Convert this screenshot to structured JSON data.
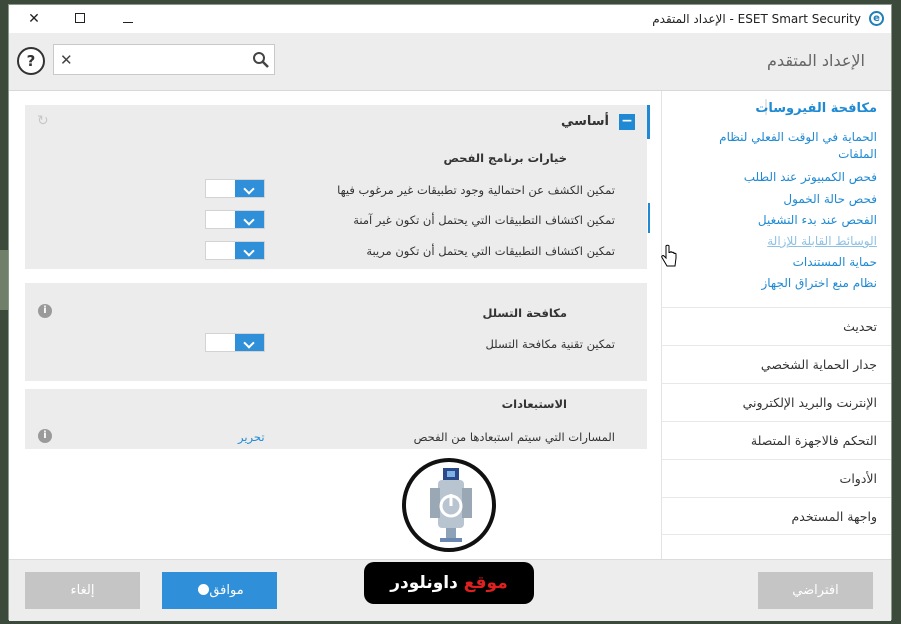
{
  "window": {
    "title": "ESET Smart Security - الإعداد المتقدم",
    "logo_letter": "e",
    "close_glyph": "✕"
  },
  "header": {
    "title": "الإعداد المتقدم",
    "help_glyph": "?",
    "search": {
      "value": "",
      "placeholder": "",
      "clear_glyph": "✕"
    }
  },
  "sidebar": {
    "section_title": "مكافحة الفيروسات",
    "sub_items": [
      {
        "label": "الحماية في الوقت الفعلي لنظام الملفات"
      },
      {
        "label": "فحص الكمبيوتر عند الطلب"
      },
      {
        "label": "فحص حالة الخمول"
      },
      {
        "label": "الفحص عند بدء التشغيل"
      },
      {
        "label": "الوسائط القابلة للإزالة"
      },
      {
        "label": "حماية المستندات"
      },
      {
        "label": "نظام منع اختراق الجهاز"
      }
    ],
    "items": [
      {
        "label": "تحديث"
      },
      {
        "label": "جدار الحماية الشخصي"
      },
      {
        "label": "الإنترنت والبريد الإلكتروني"
      },
      {
        "label": "التحكم فالاجهزة المتصلة"
      },
      {
        "label": "الأدوات"
      },
      {
        "label": "واجهة المستخدم"
      }
    ]
  },
  "main": {
    "section_title": "أساسي",
    "section_toggle": "−",
    "refresh_glyph": "↻",
    "groups": [
      {
        "title": "خيارات برنامج الفحص",
        "rows": [
          {
            "label": "تمكين الكشف عن احتمالية وجود تطبيقات غير مرغوب فيها"
          },
          {
            "label": "تمكين اكتشاف التطبيقات التي يحتمل أن تكون غير آمنة"
          },
          {
            "label": "تمكين اكتشاف التطبيقات التي يحتمل أن تكون مريبة"
          }
        ]
      },
      {
        "title": "مكافحة التسلل",
        "rows": [
          {
            "label": "تمكين تقنية مكافحة التسلل"
          }
        ]
      },
      {
        "title": "الاستبعادات",
        "rows": [
          {
            "label": "المسارات التي سيتم استبعادها من الفحص",
            "link": "تحرير"
          }
        ]
      }
    ],
    "info_glyph": "i"
  },
  "footer": {
    "cancel_label": "إلغاء",
    "ok_label": "موافق",
    "default_label": "افتراضي"
  },
  "watermark": {
    "text_red": "موقع",
    "text_white": "داونلودر"
  },
  "colors": {
    "accent": "#1f8ad3",
    "button_primary": "#2f8fd8",
    "button_disabled": "#c5c5c5",
    "header_bg": "#ededed"
  }
}
